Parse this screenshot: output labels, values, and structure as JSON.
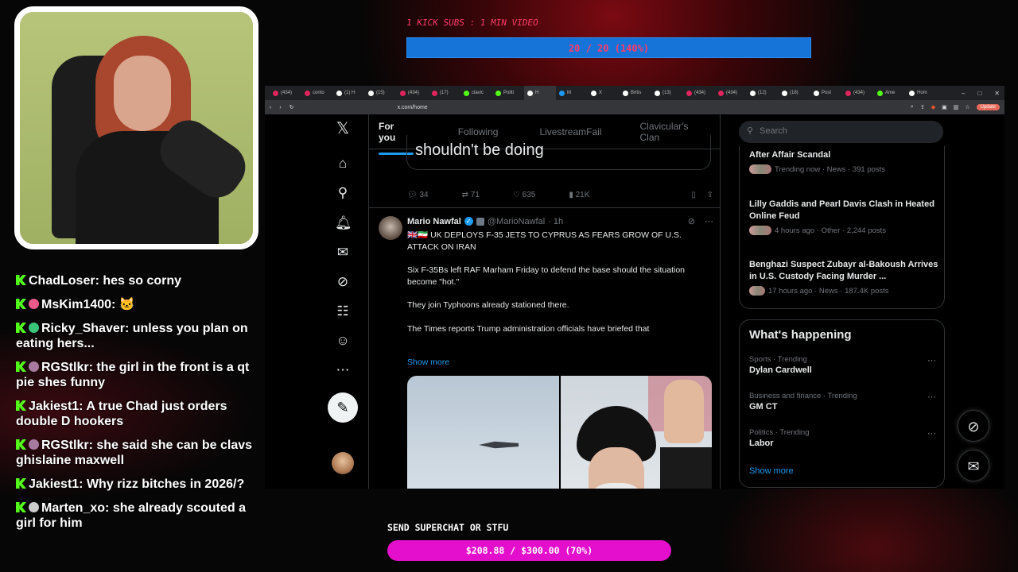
{
  "overlay": {
    "subs_goal_label": "1 KICK SUBS : 1 MIN VIDEO",
    "subs_progress_text": "20 / 20 (140%)",
    "superchat_label": "SEND SUPERCHAT OR STFU",
    "superchat_progress_text": "$208.88 / $300.00 (70%)",
    "superchat_progress": 0.7
  },
  "chat": [
    {
      "user": "ChadLoser",
      "text": "hes so corny",
      "badge": ""
    },
    {
      "user": "MsKim1400",
      "text": "🐱",
      "badge": "#e85a8a"
    },
    {
      "user": "Ricky_Shaver",
      "text": "unless you plan on eating hers...",
      "badge": "#3ac47a"
    },
    {
      "user": "RGStlkr",
      "text": "the girl in the front is a qt pie shes funny",
      "badge": "#a87aa0"
    },
    {
      "user": "Jakiest1",
      "text": "A true Chad just orders double D hookers",
      "badge": ""
    },
    {
      "user": "RGStlkr",
      "text": "she said she can be clavs ghislaine maxwell",
      "badge": "#a87aa0"
    },
    {
      "user": "Jakiest1",
      "text": "Why rizz bitches in 2026/?",
      "badge": ""
    },
    {
      "user": "Marten_xo",
      "text": "she already scouted a girl for him",
      "badge": "#cccccc"
    }
  ],
  "browser": {
    "url": "x.com/home",
    "update_label": "Update",
    "tabs": [
      {
        "label": "(434)",
        "color": "#e0245e"
      },
      {
        "label": "conto",
        "color": "#e0245e"
      },
      {
        "label": "(1) H",
        "color": "#ffffff"
      },
      {
        "label": "(15) ",
        "color": "#ffffff"
      },
      {
        "label": "(434)",
        "color": "#e0245e"
      },
      {
        "label": "(17) ",
        "color": "#e0245e"
      },
      {
        "label": "clavic",
        "color": "#53fc18"
      },
      {
        "label": "Politi",
        "color": "#53fc18"
      },
      {
        "label": "H",
        "color": "#ffffff"
      },
      {
        "label": "M",
        "color": "#1d9bf0"
      },
      {
        "label": "X",
        "color": "#ffffff"
      },
      {
        "label": "Britis",
        "color": "#ffffff"
      },
      {
        "label": "(13) ",
        "color": "#ffffff"
      },
      {
        "label": "(434)",
        "color": "#e0245e"
      },
      {
        "label": "(434)",
        "color": "#e0245e"
      },
      {
        "label": "(12) ",
        "color": "#ffffff"
      },
      {
        "label": "(18) ",
        "color": "#ffffff"
      },
      {
        "label": "Post",
        "color": "#ffffff"
      },
      {
        "label": "(434)",
        "color": "#e0245e"
      },
      {
        "label": "Ame",
        "color": "#53fc18"
      },
      {
        "label": "Hom",
        "color": "#ffffff"
      }
    ]
  },
  "x": {
    "tabs": [
      "For you",
      "Following",
      "LivestreamFail",
      "Clavicular's Clan"
    ],
    "quote_text": "shouldn't be doing",
    "prev_actions": {
      "replies": "34",
      "reposts": "71",
      "likes": "635",
      "views": "21K"
    },
    "tweet": {
      "name": "Mario Nawfal",
      "handle": "@MarioNawfal",
      "time": "· 1h",
      "headline": "🇬🇧🇮🇷 UK DEPLOYS F-35 JETS TO CYPRUS AS FEARS GROW OF U.S. ATTACK ON IRAN",
      "p1": "Six F-35Bs left RAF Marham Friday to defend the base should the situation become \"hot.\"",
      "p2": "They join Typhoons already stationed there.",
      "p3": "The Times reports Trump administration officials have briefed that",
      "show_more": "Show more"
    },
    "search_placeholder": "Search",
    "news": [
      {
        "title": "After Affair Scandal",
        "meta": "Trending now · News · 391 posts"
      },
      {
        "title": "Lilly Gaddis and Pearl Davis Clash in Heated Online Feud",
        "meta": "4 hours ago · Other · 2,244 posts"
      },
      {
        "title": "Benghazi Suspect Zubayr al-Bakoush Arrives in U.S. Custody Facing Murder ...",
        "meta": "17 hours ago · News · 187.4K posts"
      }
    ],
    "whats_happening": "What's happening",
    "trends": [
      {
        "context": "Sports · Trending",
        "name": "Dylan Cardwell"
      },
      {
        "context": "Business and finance · Trending",
        "name": "GM CT"
      },
      {
        "context": "Politics · Trending",
        "name": "Labor"
      }
    ],
    "show_more_trends": "Show more"
  }
}
